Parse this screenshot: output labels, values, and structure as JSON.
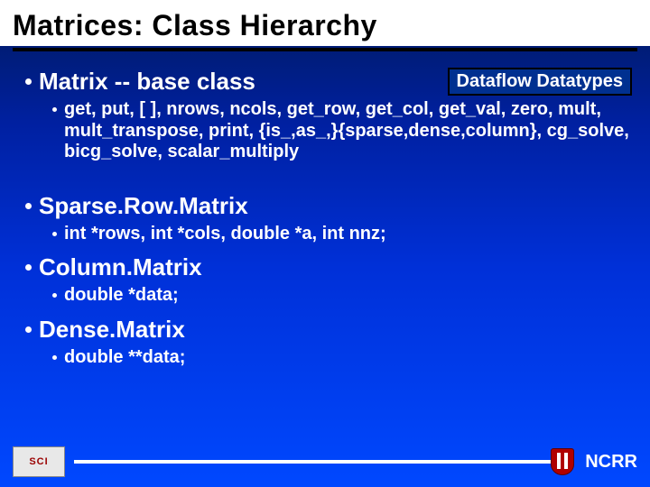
{
  "title": "Matrices: Class Hierarchy",
  "callout": "Dataflow Datatypes",
  "bullets": {
    "matrix": "Matrix -- base class",
    "matrix_sub": "get, put, [ ], nrows, ncols, get_row, get_col, get_val, zero, mult, mult_transpose, print, {is_,as_,}{sparse,dense,column}, cg_solve, bicg_solve, scalar_multiply",
    "sparse": "Sparse.Row.Matrix",
    "sparse_sub": "int *rows, int *cols, double *a, int nnz;",
    "column": "Column.Matrix",
    "column_sub": "double *data;",
    "dense": "Dense.Matrix",
    "dense_sub": "double **data;"
  },
  "footer": {
    "badge": "SCI",
    "label": "NCRR"
  }
}
